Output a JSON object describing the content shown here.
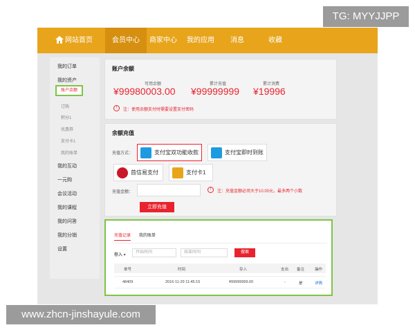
{
  "watermark": {
    "tg": "TG: MYYJJPP",
    "url": "www.zhcn-jinshayule.com"
  },
  "nav": {
    "items": [
      "网站首页",
      "会员中心",
      "商家中心",
      "我的应用",
      "消息",
      "收藏"
    ],
    "active": "会员中心",
    "color": "#e8a41b"
  },
  "sidebar": {
    "items": [
      {
        "label": "我的订单",
        "type": "main"
      },
      {
        "label": "我的资产",
        "type": "main"
      },
      {
        "label": "账户余额",
        "type": "active"
      },
      {
        "label": "订购",
        "type": "sub"
      },
      {
        "label": "积分1",
        "type": "sub"
      },
      {
        "label": "优惠券",
        "type": "sub"
      },
      {
        "label": "支付卡1",
        "type": "sub"
      },
      {
        "label": "我的账单",
        "type": "sub"
      },
      {
        "label": "我的互动",
        "type": "main"
      },
      {
        "label": "一元购",
        "type": "main"
      },
      {
        "label": "会议活动",
        "type": "main"
      },
      {
        "label": "我的课程",
        "type": "main"
      },
      {
        "label": "我的问答",
        "type": "main"
      },
      {
        "label": "我的分销",
        "type": "main"
      },
      {
        "label": "设置",
        "type": "main"
      }
    ]
  },
  "balance": {
    "title": "账户余额",
    "available_label": "可用余额",
    "available_value": "¥99980003.00",
    "recharge_label": "累计充值",
    "recharge_value": "¥99999999",
    "spent_label": "累计消费",
    "spent_value": "¥19996",
    "note": "注：使用余额支付时需要设置支付密码"
  },
  "recharge": {
    "title": "余额充值",
    "method_label": "充值方式：",
    "methods": [
      "支付宝双功能收款",
      "支付宝即时到账",
      "首信易支付",
      "支付卡1"
    ],
    "amount_label": "充值金额：",
    "amount_note": "注：充值金额必须大于10.00元，最多两个小数",
    "submit": "立即充值"
  },
  "records": {
    "tabs": [
      "充值记录",
      "我的账单"
    ],
    "filter_type": "存入",
    "start_placeholder": "开始时间",
    "end_placeholder": "结束时间",
    "search": "搜索",
    "columns": [
      "单号",
      "时间",
      "存入",
      "支出",
      "备注",
      "操作"
    ],
    "rows": [
      {
        "id": "48409",
        "time": "2016-11-29 11:45:15",
        "in": "¥99999999.00",
        "out": "-",
        "remark": "是",
        "action": "详情"
      }
    ]
  }
}
